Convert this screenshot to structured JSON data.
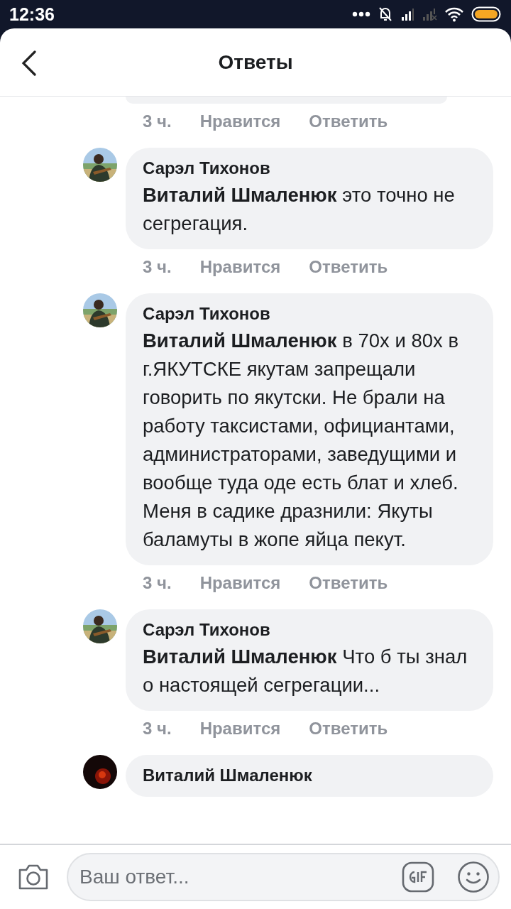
{
  "status_bar": {
    "time": "12:36"
  },
  "header": {
    "title": "Ответы"
  },
  "comments": [
    {
      "kind": "cut_top",
      "time": "3 ч.",
      "like": "Нравится",
      "reply": "Ответить"
    },
    {
      "kind": "full",
      "author": "Сарэл Тихонов",
      "text": "**Виталий Шмаленюк** это точно не сегрегация.",
      "time": "3 ч.",
      "like": "Нравится",
      "reply": "Ответить"
    },
    {
      "kind": "full",
      "author": "Сарэл Тихонов",
      "text": "**Виталий Шмаленюк** в 70х и 80х в г.ЯКУТСКЕ  якутам запрещали говорить по якутски. Не брали на работу таксистами, официантами, администраторами, заведущими и вообще туда оде есть блат и хлеб. Меня в садике дразнили: Якуты баламуты в жопе яйца пекут.",
      "time": "3 ч.",
      "like": "Нравится",
      "reply": "Ответить"
    },
    {
      "kind": "full",
      "author": "Сарэл Тихонов",
      "text": "**Виталий Шмаленюк** Что б ты знал о настоящей сегрегации...",
      "time": "3 ч.",
      "like": "Нравится",
      "reply": "Ответить"
    },
    {
      "kind": "cut_bottom",
      "author": "Виталий Шмаленюк"
    }
  ],
  "composer": {
    "placeholder": "Ваш ответ..."
  }
}
